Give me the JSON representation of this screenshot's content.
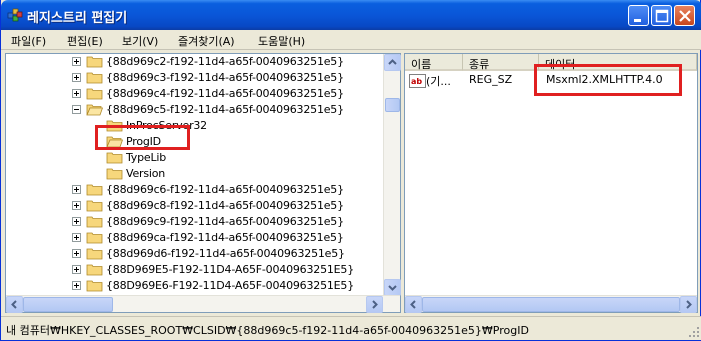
{
  "window": {
    "title": "레지스트리 편집기",
    "colors": {
      "title_bar": "#0a56d8",
      "highlight": "#e02020",
      "selection": "#316ac5"
    }
  },
  "title_buttons": [
    "minimize-icon",
    "maximize-icon",
    "close-icon"
  ],
  "menu": [
    {
      "label": "파일(F)"
    },
    {
      "label": "편집(E)"
    },
    {
      "label": "보기(V)"
    },
    {
      "label": "즐겨찾기(A)"
    },
    {
      "label": "도움말(H)"
    }
  ],
  "tree": {
    "items": [
      {
        "label": "{88d969c2-f192-11d4-a65f-0040963251e5}",
        "expander": "plus",
        "level": 0
      },
      {
        "label": "{88d969c3-f192-11d4-a65f-0040963251e5}",
        "expander": "plus",
        "level": 0
      },
      {
        "label": "{88d969c4-f192-11d4-a65f-0040963251e5}",
        "expander": "plus",
        "level": 0
      },
      {
        "label": "{88d969c5-f192-11d4-a65f-0040963251e5}",
        "expander": "minus",
        "level": 0
      },
      {
        "label": "InProcServer32",
        "expander": "none",
        "level": 1
      },
      {
        "label": "ProgID",
        "expander": "none",
        "level": 1,
        "highlighted": true
      },
      {
        "label": "TypeLib",
        "expander": "none",
        "level": 1
      },
      {
        "label": "Version",
        "expander": "none",
        "level": 1
      },
      {
        "label": "{88d969c6-f192-11d4-a65f-0040963251e5}",
        "expander": "plus",
        "level": 0
      },
      {
        "label": "{88d969c8-f192-11d4-a65f-0040963251e5}",
        "expander": "plus",
        "level": 0
      },
      {
        "label": "{88d969c9-f192-11d4-a65f-0040963251e5}",
        "expander": "plus",
        "level": 0
      },
      {
        "label": "{88d969ca-f192-11d4-a65f-0040963251e5}",
        "expander": "plus",
        "level": 0
      },
      {
        "label": "{88d969d6-f192-11d4-a65f-0040963251e5}",
        "expander": "plus",
        "level": 0
      },
      {
        "label": "{88D969E5-F192-11D4-A65F-0040963251E5}",
        "expander": "plus",
        "level": 0
      },
      {
        "label": "{88D969E6-F192-11D4-A65F-0040963251E5}",
        "expander": "plus",
        "level": 0
      }
    ]
  },
  "list": {
    "columns": [
      "이름",
      "종류",
      "데이터"
    ],
    "rows": [
      {
        "name": "(기...",
        "type": "REG_SZ",
        "data": "Msxml2.XMLHTTP.4.0",
        "icon": "string-value-icon"
      }
    ]
  },
  "status": {
    "path": "내 컴퓨터₩HKEY_CLASSES_ROOT₩CLSID₩{88d969c5-f192-11d4-a65f-0040963251e5}₩ProgID"
  }
}
